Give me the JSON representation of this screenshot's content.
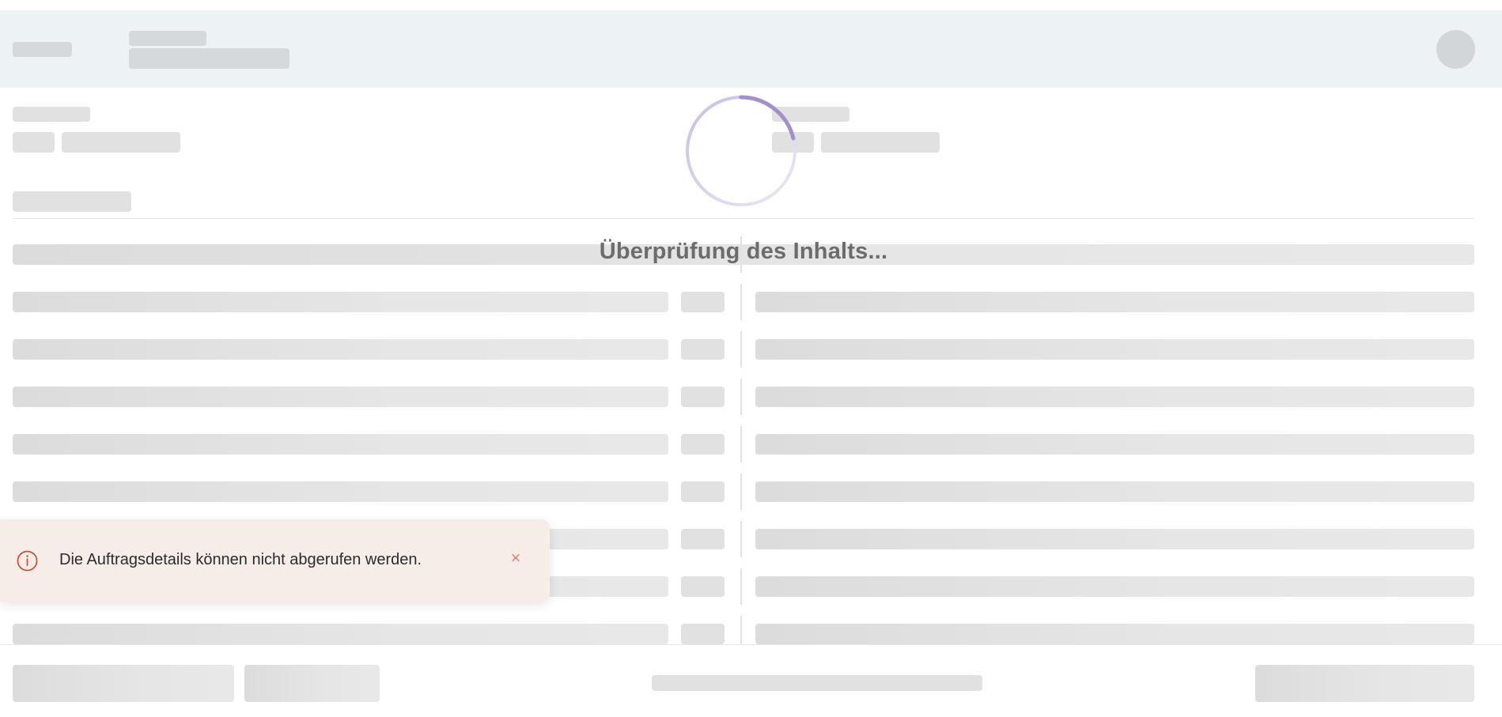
{
  "loading": {
    "message": "Überprüfung des Inhalts...",
    "spinner_color": "#a48fcb"
  },
  "toast": {
    "message": "Die Auftragsdetails können nicht abgerufen werden.",
    "icon": "info-circle-icon",
    "close_icon": "close-icon",
    "close_glyph": "×",
    "accent_color": "#c4503a",
    "background": "#f7ede8"
  },
  "colors": {
    "header_bg": "#edf2f5",
    "skeleton": "#e1e1e1"
  }
}
